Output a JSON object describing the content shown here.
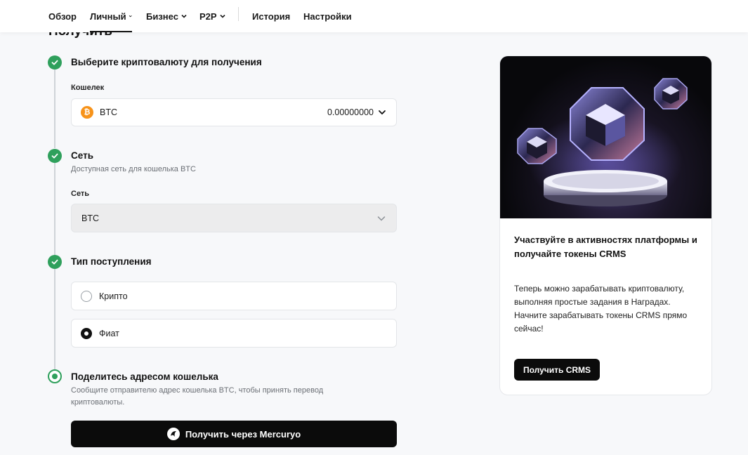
{
  "nav": {
    "items": [
      {
        "label": "Обзор",
        "dropdown": false,
        "active": false
      },
      {
        "label": "Личный",
        "dropdown": true,
        "active": true
      },
      {
        "label": "Бизнес",
        "dropdown": true,
        "active": false
      },
      {
        "label": "P2P",
        "dropdown": true,
        "active": false
      },
      {
        "label": "История",
        "dropdown": false,
        "active": false
      },
      {
        "label": "Настройки",
        "dropdown": false,
        "active": false
      }
    ]
  },
  "page": {
    "title": "Получить"
  },
  "steps": {
    "currency": {
      "title": "Выберите криптовалюту для получения",
      "field_label": "Кошелек",
      "coin": "BTC",
      "balance": "0.00000000"
    },
    "network": {
      "title": "Сеть",
      "subtitle": "Доступная сеть для кошелька BTC",
      "field_label": "Сеть",
      "value": "BTC"
    },
    "type": {
      "title": "Тип поступления",
      "options": [
        {
          "label": "Крипто",
          "checked": false
        },
        {
          "label": "Фиат",
          "checked": true
        }
      ]
    },
    "share": {
      "title": "Поделитесь адресом кошелька",
      "subtitle_line1": "Сообщите отправителю адрес кошелька BTC, чтобы принять перевод",
      "subtitle_line2": "криптовалюты."
    }
  },
  "cta": {
    "label": "Получить через Mercuryo"
  },
  "promo": {
    "title": "Участвуйте в активностях платформы и получайте токены CRMS",
    "text": "Теперь можно зарабатывать криптовалюту, выполняя простые задания в Наградах. Начните зарабатывать токены CRMS прямо сейчас!",
    "button": "Получить CRMS"
  },
  "colors": {
    "success": "#2fa05c",
    "btc": "#f7931a",
    "primary_button": "#0b0b0b"
  }
}
